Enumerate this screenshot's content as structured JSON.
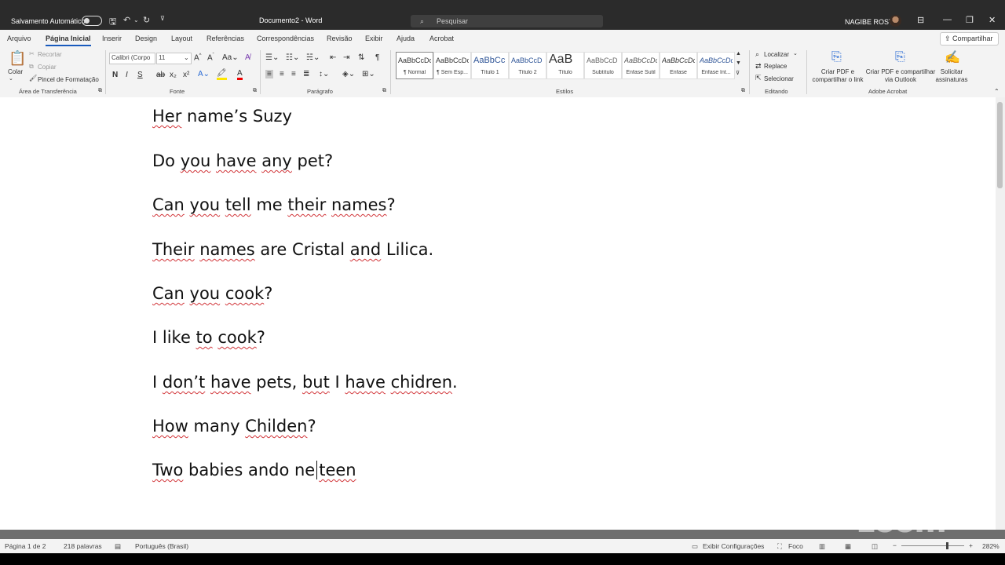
{
  "titlebar": {
    "autosave_label": "Salvamento Automático",
    "doc_title": "Documento2  -  Word",
    "search_placeholder": "Pesquisar",
    "user_name": "NAGIBE ROSTI"
  },
  "tabs": [
    "Arquivo",
    "Página Inicial",
    "Inserir",
    "Design",
    "Layout",
    "Referências",
    "Correspondências",
    "Revisão",
    "Exibir",
    "Ajuda",
    "Acrobat"
  ],
  "share_label": "Compartilhar",
  "ribbon": {
    "clipboard": {
      "paste": "Colar",
      "cut": "Recortar",
      "copy": "Copiar",
      "format_painter": "Pincel de Formatação",
      "group": "Área de Transferência"
    },
    "font": {
      "family": "Calibri (Corpo",
      "size": "11",
      "bold": "N",
      "italic": "I",
      "underline": "S",
      "strike": "ab",
      "sub": "x₂",
      "sup": "x²",
      "group": "Fonte"
    },
    "paragraph": {
      "group": "Parágrafo"
    },
    "styles": {
      "items": [
        {
          "sample": "AaBbCcDc",
          "name": "¶ Normal"
        },
        {
          "sample": "AaBbCcDc",
          "name": "¶ Sem Esp..."
        },
        {
          "sample": "AaBbCc",
          "name": "Título 1"
        },
        {
          "sample": "AaBbCcD",
          "name": "Título 2"
        },
        {
          "sample": "AaB",
          "name": "Título"
        },
        {
          "sample": "AaBbCcD",
          "name": "Subtítulo"
        },
        {
          "sample": "AaBbCcDc",
          "name": "Ênfase Sutil"
        },
        {
          "sample": "AaBbCcDc",
          "name": "Ênfase"
        },
        {
          "sample": "AaBbCcDc",
          "name": "Ênfase Int..."
        }
      ],
      "group": "Estilos"
    },
    "editing": {
      "find": "Localizar",
      "replace": "Replace",
      "select": "Selecionar",
      "group": "Editando"
    },
    "acrobat": {
      "create_share": "Criar PDF e compartilhar o link",
      "create_outlook": "Criar PDF e compartilhar via Outlook",
      "request_sign": "Solicitar assinaturas",
      "group": "Adobe Acrobat"
    }
  },
  "document": {
    "lines": [
      "Her name’s Suzy",
      "Do you have any pet?",
      "Can you tell me their names?",
      "Their names are Cristal and Lilica.",
      "Can you cook?",
      "I like to cook?",
      "I don’t have pets, but I have chidren.",
      "How many Childen?",
      "Two babies ando ne teen"
    ]
  },
  "status": {
    "page": "Página 1 de 2",
    "words": "218 palavras",
    "language": "Português (Brasil)",
    "display_settings": "Exibir Configurações",
    "focus": "Foco",
    "zoom": "282%"
  },
  "watermark": "zoom"
}
